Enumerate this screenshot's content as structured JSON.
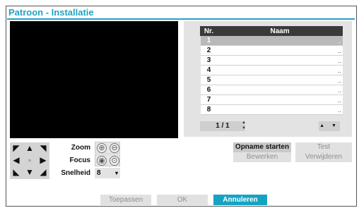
{
  "dialog": {
    "title": "Patroon - Installatie"
  },
  "table": {
    "headers": [
      "Nr.",
      "Naam"
    ],
    "rows": [
      {
        "nr": "1",
        "naam": "",
        "dots": ".."
      },
      {
        "nr": "2",
        "naam": "",
        "dots": ".."
      },
      {
        "nr": "3",
        "naam": "",
        "dots": ".."
      },
      {
        "nr": "4",
        "naam": "",
        "dots": ".."
      },
      {
        "nr": "5",
        "naam": "",
        "dots": ".."
      },
      {
        "nr": "6",
        "naam": "",
        "dots": ".."
      },
      {
        "nr": "7",
        "naam": "",
        "dots": ".."
      },
      {
        "nr": "8",
        "naam": "",
        "dots": ".."
      }
    ],
    "selected_row": "1"
  },
  "pager": {
    "text": "1 / 1",
    "spin_up": "▲",
    "spin_down": "▼",
    "nav": "▲ ▼"
  },
  "ptz": {
    "up_left": "◤",
    "up": "▲",
    "up_right": "◥",
    "left": "◀",
    "center": "●",
    "right": "▶",
    "down_left": "◣",
    "down": "▼",
    "down_right": "◢"
  },
  "lens": {
    "zoom_label": "Zoom",
    "focus_label": "Focus",
    "speed_label": "Snelheid",
    "zoom_in": "⊕",
    "zoom_out": "⊖",
    "focus_near": "◉",
    "focus_far": "⊙",
    "speed_value": "8",
    "speed_arrow": "▾"
  },
  "actions": {
    "start_recording": "Opname starten",
    "test": "Test",
    "edit": "Bewerken",
    "delete": "Verwijderen"
  },
  "footer": {
    "apply": "Toepassen",
    "ok": "OK",
    "cancel": "Annuleren"
  },
  "colors": {
    "accent": "#1fa3c4",
    "cancel_button": "#16a3c2"
  }
}
